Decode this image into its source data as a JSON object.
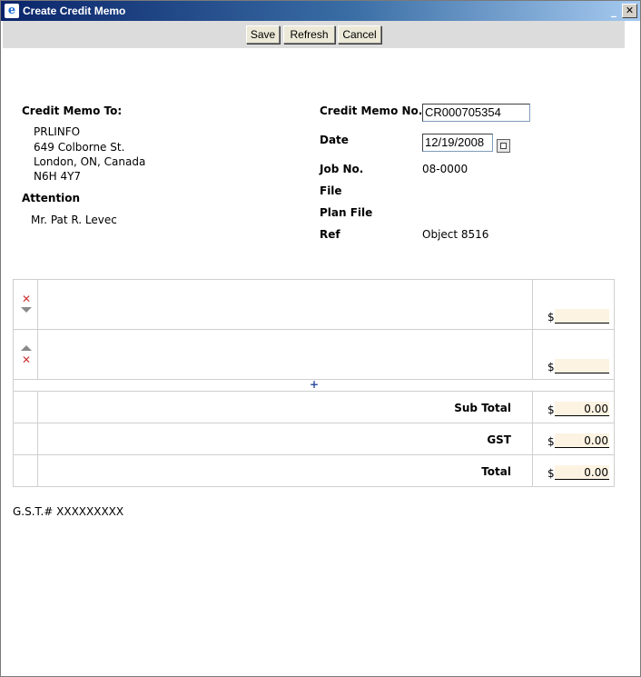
{
  "window": {
    "title": "Create Credit Memo",
    "minimize": "_",
    "close": "✕"
  },
  "toolbar": {
    "save_label": "Save",
    "refresh_label": "Refresh",
    "cancel_label": "Cancel"
  },
  "bill_to": {
    "heading": "Credit Memo To:",
    "lines": [
      "PRLINFO",
      "649 Colborne St.",
      "London, ON, Canada",
      "N6H 4Y7"
    ],
    "attention_label": "Attention",
    "attention_value": "Mr. Pat R. Levec"
  },
  "memo": {
    "number_label": "Credit Memo No.",
    "number_value": "CR000705354",
    "date_label": "Date",
    "date_value": "12/19/2008",
    "job_label": "Job No.",
    "job_value": "08-0000",
    "file_label": "File",
    "plan_file_label": "Plan File",
    "ref_label": "Ref",
    "ref_value": "Object 8516"
  },
  "lines": {
    "currency": "$",
    "add_symbol": "+",
    "remove_symbol": "✕",
    "items": [
      {
        "amount": ""
      },
      {
        "amount": ""
      }
    ]
  },
  "totals": {
    "subtotal_label": "Sub Total",
    "subtotal_value": "0.00",
    "gst_label": "GST",
    "gst_value": "0.00",
    "total_label": "Total",
    "total_value": "0.00"
  },
  "footer": {
    "gst_number": "G.S.T.# XXXXXXXXX"
  },
  "colors": {
    "amount_bg": "#fdf3e2",
    "title_start": "#0a246a",
    "remove_icon": "#cc3333"
  }
}
